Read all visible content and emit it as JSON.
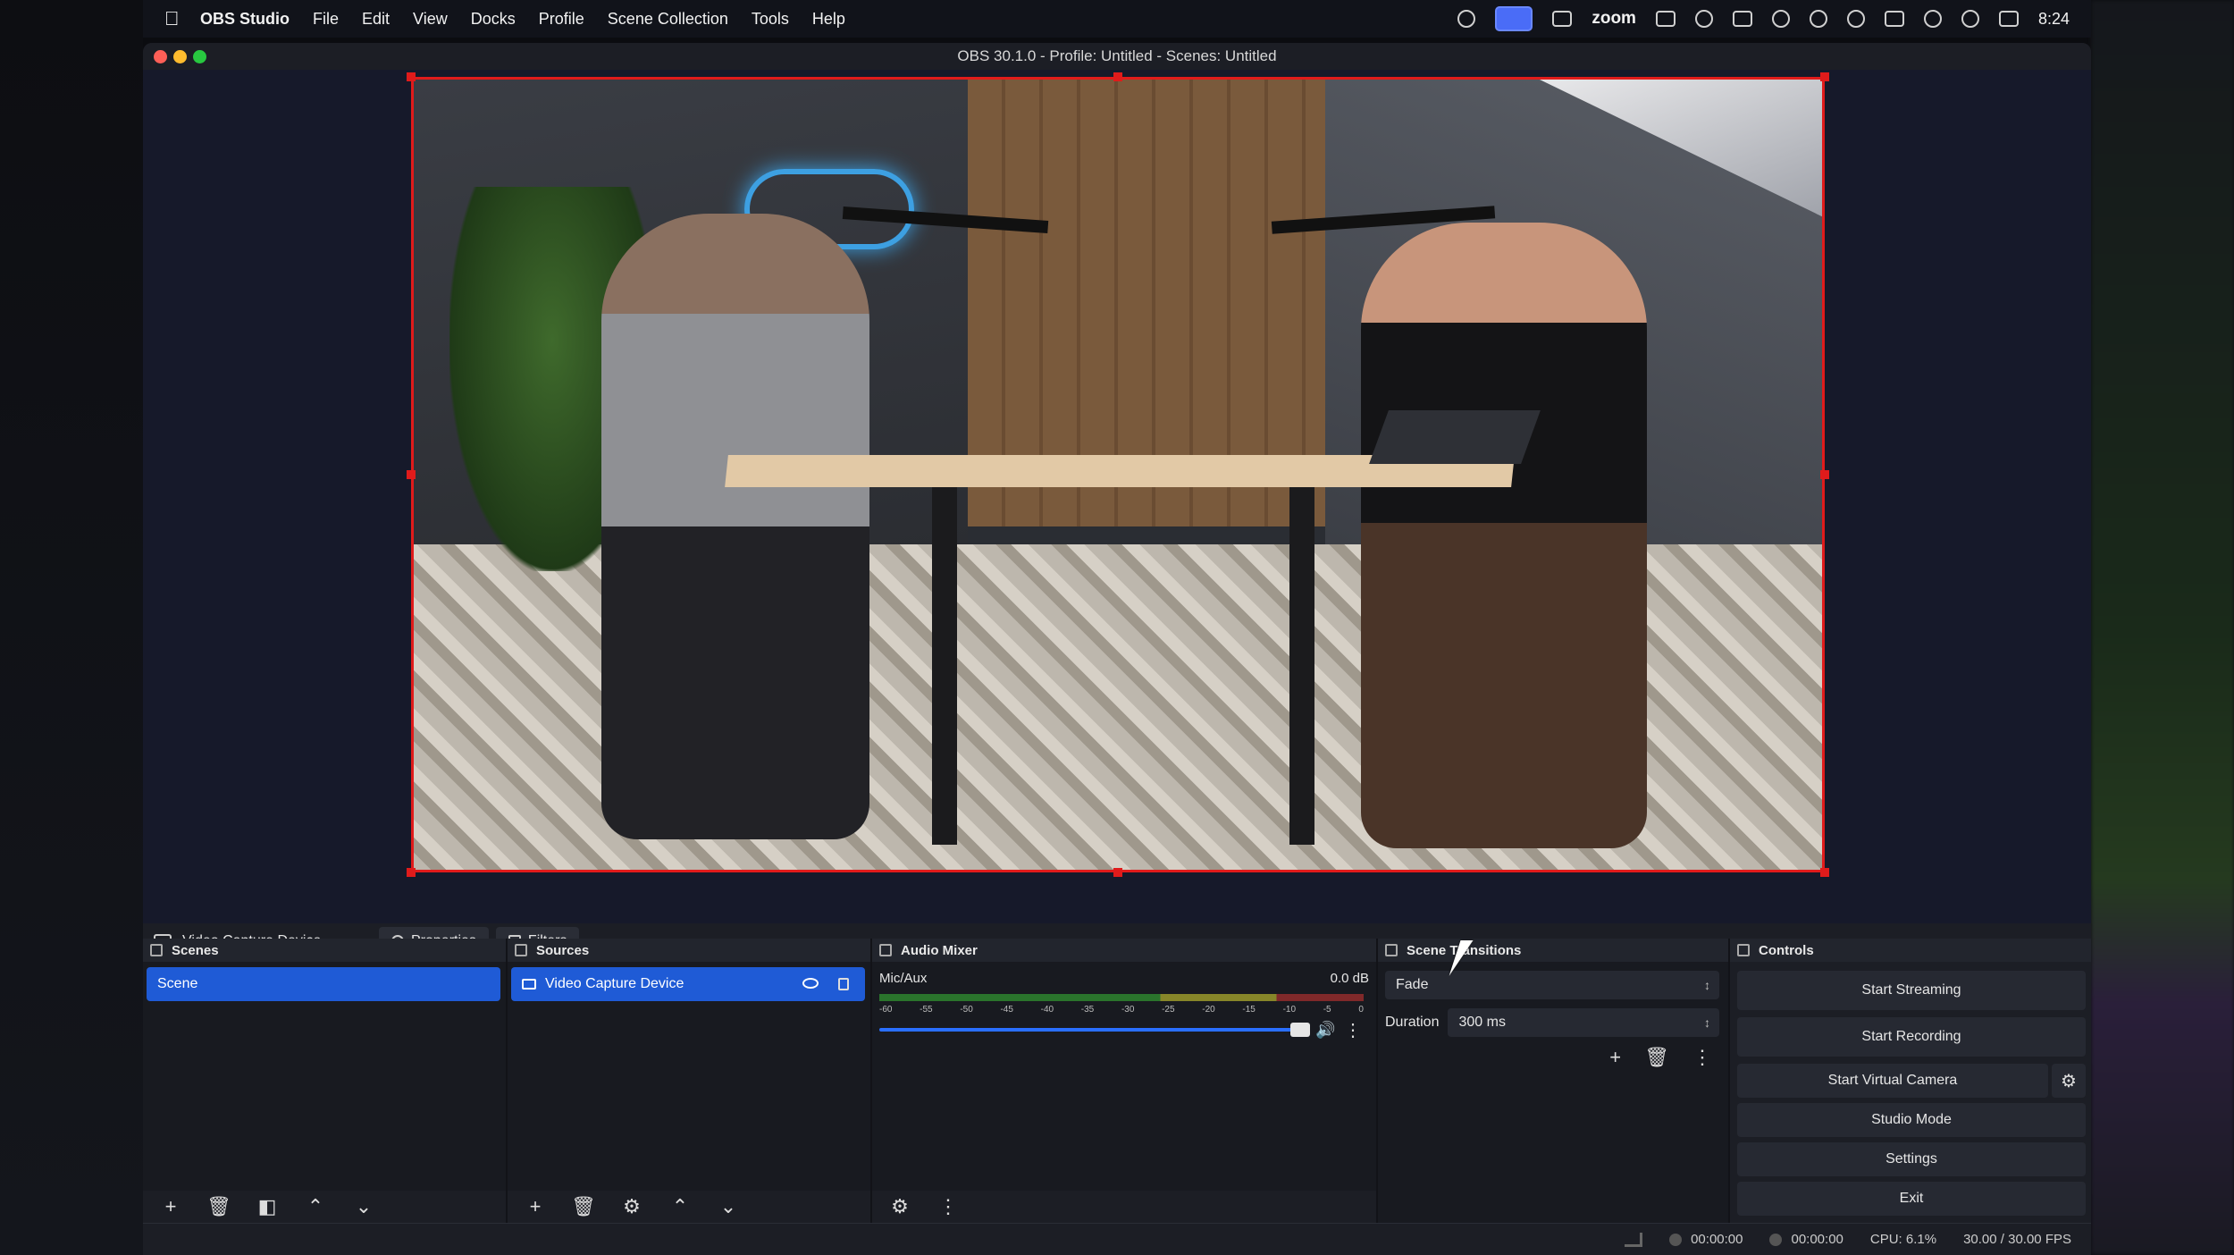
{
  "menubar": {
    "app_name": "OBS Studio",
    "items": [
      "File",
      "Edit",
      "View",
      "Docks",
      "Profile",
      "Scene Collection",
      "Tools",
      "Help"
    ],
    "tray_zoom": "zoom",
    "clock": "8:24"
  },
  "window": {
    "title": "OBS 30.1.0 - Profile: Untitled - Scenes: Untitled"
  },
  "source_toolbar": {
    "source_name": "Video Capture Device",
    "properties_label": "Properties",
    "filters_label": "Filters"
  },
  "docks": {
    "scenes": {
      "title": "Scenes",
      "items": [
        "Scene"
      ]
    },
    "sources": {
      "title": "Sources",
      "items": [
        "Video Capture Device"
      ]
    },
    "mixer": {
      "title": "Audio Mixer",
      "channel": "Mic/Aux",
      "level": "0.0 dB",
      "ticks": [
        "-60",
        "-55",
        "-50",
        "-45",
        "-40",
        "-35",
        "-30",
        "-25",
        "-20",
        "-15",
        "-10",
        "-5",
        "0"
      ]
    },
    "transitions": {
      "title": "Scene Transitions",
      "selected": "Fade",
      "duration_label": "Duration",
      "duration_value": "300 ms"
    },
    "controls": {
      "title": "Controls",
      "start_streaming": "Start Streaming",
      "start_recording": "Start Recording",
      "start_virtual_camera": "Start Virtual Camera",
      "studio_mode": "Studio Mode",
      "settings": "Settings",
      "exit": "Exit"
    }
  },
  "statusbar": {
    "stream_time": "00:00:00",
    "record_time": "00:00:00",
    "cpu": "CPU: 6.1%",
    "fps": "30.00 / 30.00 FPS"
  },
  "colors": {
    "selection_blue": "#1f5bd6",
    "preview_border": "#e01b1b",
    "panel_bg": "#1c1e25"
  }
}
